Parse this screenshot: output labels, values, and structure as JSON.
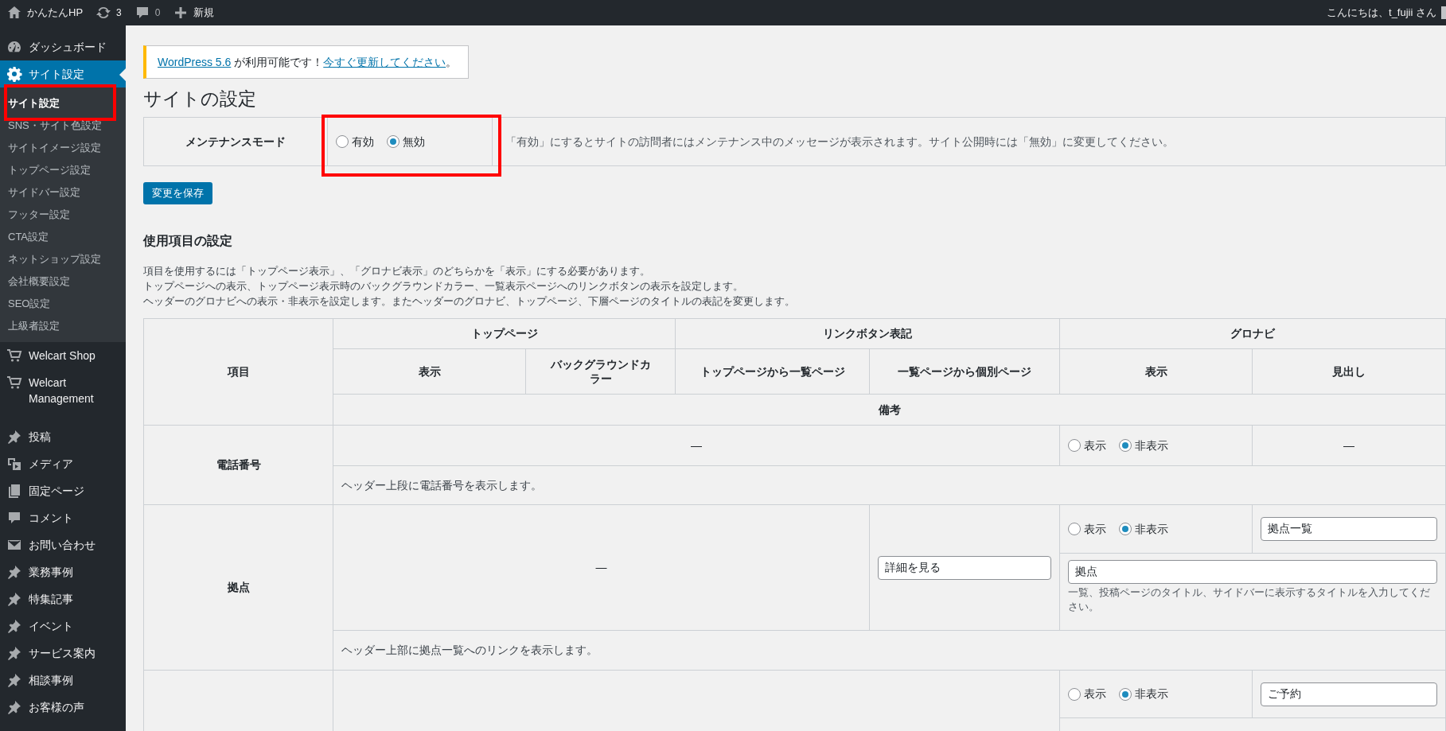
{
  "admin_bar": {
    "site_name": "かんたんHP",
    "updates": "3",
    "comments": "0",
    "new_label": "新規",
    "greeting": "こんにちは、t_fujii さん"
  },
  "sidebar": {
    "items": [
      {
        "label": "ダッシュボード",
        "kind": "dashboard",
        "selected": false
      },
      {
        "label": "サイト設定",
        "kind": "gear",
        "selected": true,
        "children": [
          {
            "label": "サイト設定",
            "selected": true,
            "annotated": true
          },
          {
            "label": "SNS・サイト色設定",
            "selected": false,
            "annotated": false
          },
          {
            "label": "サイトイメージ設定",
            "selected": false,
            "annotated": false
          },
          {
            "label": "トップページ設定",
            "selected": false,
            "annotated": false
          },
          {
            "label": "サイドバー設定",
            "selected": false,
            "annotated": false
          },
          {
            "label": "フッター設定",
            "selected": false,
            "annotated": false
          },
          {
            "label": "CTA設定",
            "selected": false,
            "annotated": false
          },
          {
            "label": "ネットショップ設定",
            "selected": false,
            "annotated": false
          },
          {
            "label": "会社概要設定",
            "selected": false,
            "annotated": false
          },
          {
            "label": "SEO設定",
            "selected": false,
            "annotated": false
          },
          {
            "label": "上級者設定",
            "selected": false,
            "annotated": false
          }
        ]
      },
      {
        "label": "Welcart Shop",
        "kind": "cart",
        "selected": false
      },
      {
        "label": "Welcart Management",
        "kind": "cart",
        "selected": false
      },
      {
        "label": "投稿",
        "kind": "pin",
        "selected": false
      },
      {
        "label": "メディア",
        "kind": "media",
        "selected": false
      },
      {
        "label": "固定ページ",
        "kind": "page",
        "selected": false
      },
      {
        "label": "コメント",
        "kind": "comment",
        "selected": false
      },
      {
        "label": "お問い合わせ",
        "kind": "mail",
        "selected": false
      },
      {
        "label": "業務事例",
        "kind": "pin",
        "selected": false
      },
      {
        "label": "特集記事",
        "kind": "pin",
        "selected": false
      },
      {
        "label": "イベント",
        "kind": "pin",
        "selected": false
      },
      {
        "label": "サービス案内",
        "kind": "pin",
        "selected": false
      },
      {
        "label": "相談事例",
        "kind": "pin",
        "selected": false
      },
      {
        "label": "お客様の声",
        "kind": "pin",
        "selected": false
      }
    ]
  },
  "notice": {
    "version_link": "WordPress 5.6",
    "text": " が利用可能です！",
    "update_link": "今すぐ更新してください",
    "suffix": "。"
  },
  "page_title": "サイトの設定",
  "maintenance": {
    "label": "メンテナンスモード",
    "annotated": true,
    "options": [
      {
        "label": "有効",
        "selected": false
      },
      {
        "label": "無効",
        "selected": true
      }
    ],
    "description": "「有効」にするとサイトの訪問者にはメンテナンス中のメッセージが表示されます。サイト公開時には「無効」に変更してください。"
  },
  "save_button": "変更を保存",
  "section": {
    "title": "使用項目の設定",
    "description": [
      "項目を使用するには「トップページ表示」、「グロナビ表示」のどちらかを「表示」にする必要があります。",
      "トップページへの表示、トップページ表示時のバックグラウンドカラー、一覧表示ページへのリンクボタンの表示を設定します。",
      "ヘッダーのグロナビへの表示・非表示を設定します。またヘッダーのグロナビ、トップページ、下層ページのタイトルの表記を変更します。"
    ]
  },
  "table": {
    "item_header": "項目",
    "groups": [
      "トップページ",
      "リンクボタン表記",
      "グロナビ"
    ],
    "columns": [
      "表示",
      "バックグラウンドカラー",
      "トップページから一覧ページ",
      "一覧ページから個別ページ",
      "表示",
      "見出し"
    ],
    "remarks_header": "備考",
    "rows": [
      {
        "kind": "merged",
        "label": "電話番号",
        "main": "—",
        "gnav_options": [
          {
            "label": "表示",
            "selected": false
          },
          {
            "label": "非表示",
            "selected": true
          }
        ],
        "heading": {
          "kind": "text",
          "text": "—"
        },
        "note": "ヘッダー上段に電話番号を表示します。"
      },
      {
        "kind": "link",
        "label": "拠点",
        "main": "—",
        "link_field": "詳細を見る",
        "gnav_options": [
          {
            "label": "表示",
            "selected": false
          },
          {
            "label": "非表示",
            "selected": true
          }
        ],
        "heading": {
          "kind": "field",
          "value": "拠点一覧"
        },
        "title_field": "拠点",
        "title_help": "一覧、投稿ページのタイトル、サイドバーに表示するタイトルを入力してください。",
        "note": "ヘッダー上部に拠点一覧へのリンクを表示します。"
      },
      {
        "kind": "partial",
        "gnav_options": [
          {
            "label": "表示",
            "selected": false
          },
          {
            "label": "非表示",
            "selected": true
          }
        ],
        "heading": {
          "kind": "field",
          "value": "ご予約"
        }
      }
    ]
  }
}
